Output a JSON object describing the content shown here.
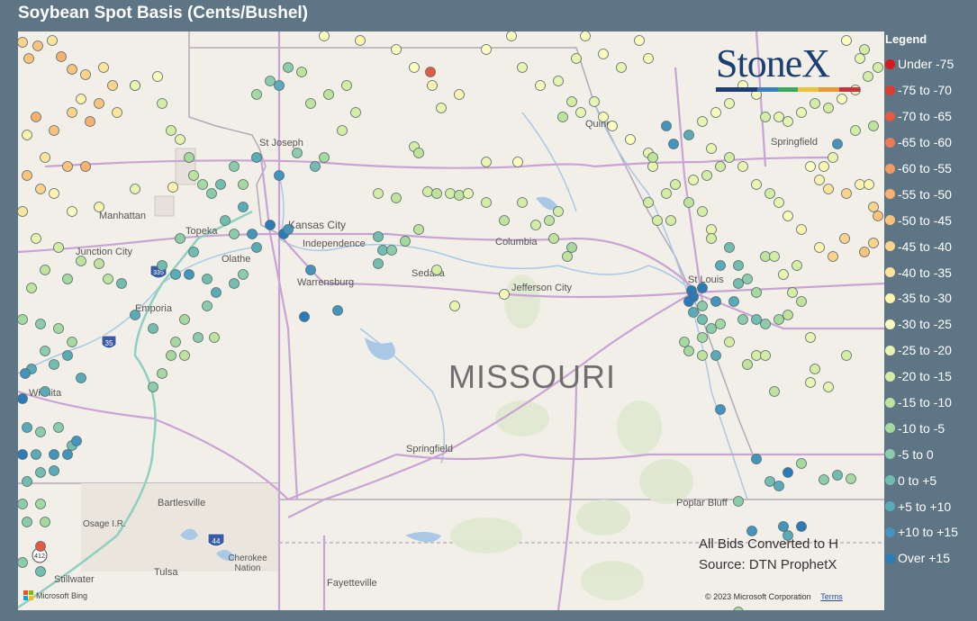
{
  "title": "Soybean Spot Basis (Cents/Bushel)",
  "map": {
    "state_label": "MISSOURI",
    "cities": [
      {
        "name": "St Joseph"
      },
      {
        "name": "Kansas City"
      },
      {
        "name": "Independence"
      },
      {
        "name": "Manhattan"
      },
      {
        "name": "Topeka"
      },
      {
        "name": "Junction City"
      },
      {
        "name": "Olathe"
      },
      {
        "name": "Columbia"
      },
      {
        "name": "Sedalia"
      },
      {
        "name": "Warrensburg"
      },
      {
        "name": "Jefferson City"
      },
      {
        "name": "Emporia"
      },
      {
        "name": "Wichita"
      },
      {
        "name": "Springfield"
      },
      {
        "name": "Bartlesville"
      },
      {
        "name": "Osage I.R."
      },
      {
        "name": "Tulsa"
      },
      {
        "name": "Stillwater"
      },
      {
        "name": "Cherokee Nation"
      },
      {
        "name": "Fayetteville"
      },
      {
        "name": "Poplar Bluff"
      },
      {
        "name": "St Louis"
      },
      {
        "name": "Quincy"
      },
      {
        "name": "Springfield"
      }
    ],
    "highway_shields": [
      {
        "label": "35",
        "color": "#3b5ba5"
      },
      {
        "label": "335",
        "color": "#3b5ba5"
      },
      {
        "label": "44",
        "color": "#3b5ba5"
      },
      {
        "label": "412",
        "color": "#ffffff"
      }
    ],
    "logo": {
      "text": "StoneX",
      "bar_colors": [
        "#1c3f73",
        "#1c3f73",
        "#3a7fc1",
        "#3aa860",
        "#e8c53a",
        "#e89a3a",
        "#c8343a"
      ]
    },
    "notes": [
      "All Bids Converted to H",
      "Source: DTN ProphetX"
    ],
    "copyright": "© 2023 Microsoft Corporation",
    "terms_label": "Terms",
    "provider_label": "Microsoft Bing"
  },
  "legend": {
    "title": "Legend",
    "items": [
      {
        "label": "Under -75",
        "color": "#d7191c"
      },
      {
        "label": "-75 to -70",
        "color": "#de3b30"
      },
      {
        "label": "-70 to -65",
        "color": "#e55a41"
      },
      {
        "label": "-65 to -60",
        "color": "#ec7a52"
      },
      {
        "label": "-60 to -55",
        "color": "#f39a64"
      },
      {
        "label": "-55 to -50",
        "color": "#f8b16f"
      },
      {
        "label": "-50 to -45",
        "color": "#fbc27b"
      },
      {
        "label": "-45 to -40",
        "color": "#fdd38b"
      },
      {
        "label": "-40 to -35",
        "color": "#fee49b"
      },
      {
        "label": "-35 to -30",
        "color": "#fef4ad"
      },
      {
        "label": "-30 to -25",
        "color": "#fbfbbd"
      },
      {
        "label": "-25 to -20",
        "color": "#e8f4b0"
      },
      {
        "label": "-20 to -15",
        "color": "#d4eca4"
      },
      {
        "label": "-15 to -10",
        "color": "#bfe39c"
      },
      {
        "label": "-10 to -5",
        "color": "#a6d9a0"
      },
      {
        "label": "-5 to 0",
        "color": "#8cccaa"
      },
      {
        "label": "0 to +5",
        "color": "#73bdb0"
      },
      {
        "label": "+5 to +10",
        "color": "#5aaab8"
      },
      {
        "label": "+10 to +15",
        "color": "#4494be"
      },
      {
        "label": "Over +15",
        "color": "#2b7bba"
      }
    ]
  }
}
